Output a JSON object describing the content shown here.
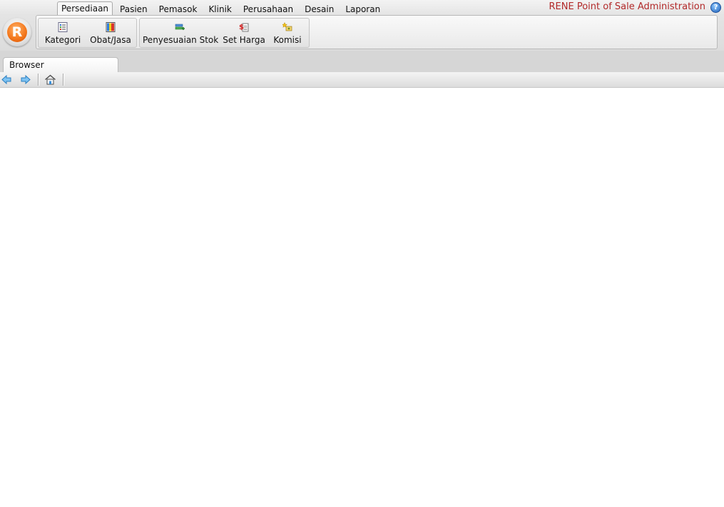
{
  "app": {
    "title": "RENE Point of Sale Administration",
    "logo_letter": "R",
    "accent_color": "#b22a2a",
    "orb_color": "#f47a1f"
  },
  "ribbon": {
    "tabs": [
      {
        "label": "Persediaan",
        "active": true
      },
      {
        "label": "Pasien",
        "active": false
      },
      {
        "label": "Pemasok",
        "active": false
      },
      {
        "label": "Klinik",
        "active": false
      },
      {
        "label": "Perusahaan",
        "active": false
      },
      {
        "label": "Desain",
        "active": false
      },
      {
        "label": "Laporan",
        "active": false
      }
    ],
    "groups": [
      {
        "buttons": [
          {
            "label": "Kategori",
            "icon": "category-list-icon"
          },
          {
            "label": "Obat/Jasa",
            "icon": "medicine-service-icon"
          }
        ]
      },
      {
        "buttons": [
          {
            "label": "Penyesuaian Stok",
            "icon": "stock-adjustment-icon"
          },
          {
            "label": "Set Harga",
            "icon": "set-price-icon"
          },
          {
            "label": "Komisi",
            "icon": "commission-icon"
          }
        ]
      }
    ]
  },
  "document_tabs": [
    {
      "label": "Browser",
      "active": true
    }
  ],
  "browser_toolbar": {
    "buttons": [
      {
        "icon": "back-arrow-icon"
      },
      {
        "icon": "forward-arrow-icon"
      },
      {
        "icon": "home-icon"
      }
    ]
  }
}
